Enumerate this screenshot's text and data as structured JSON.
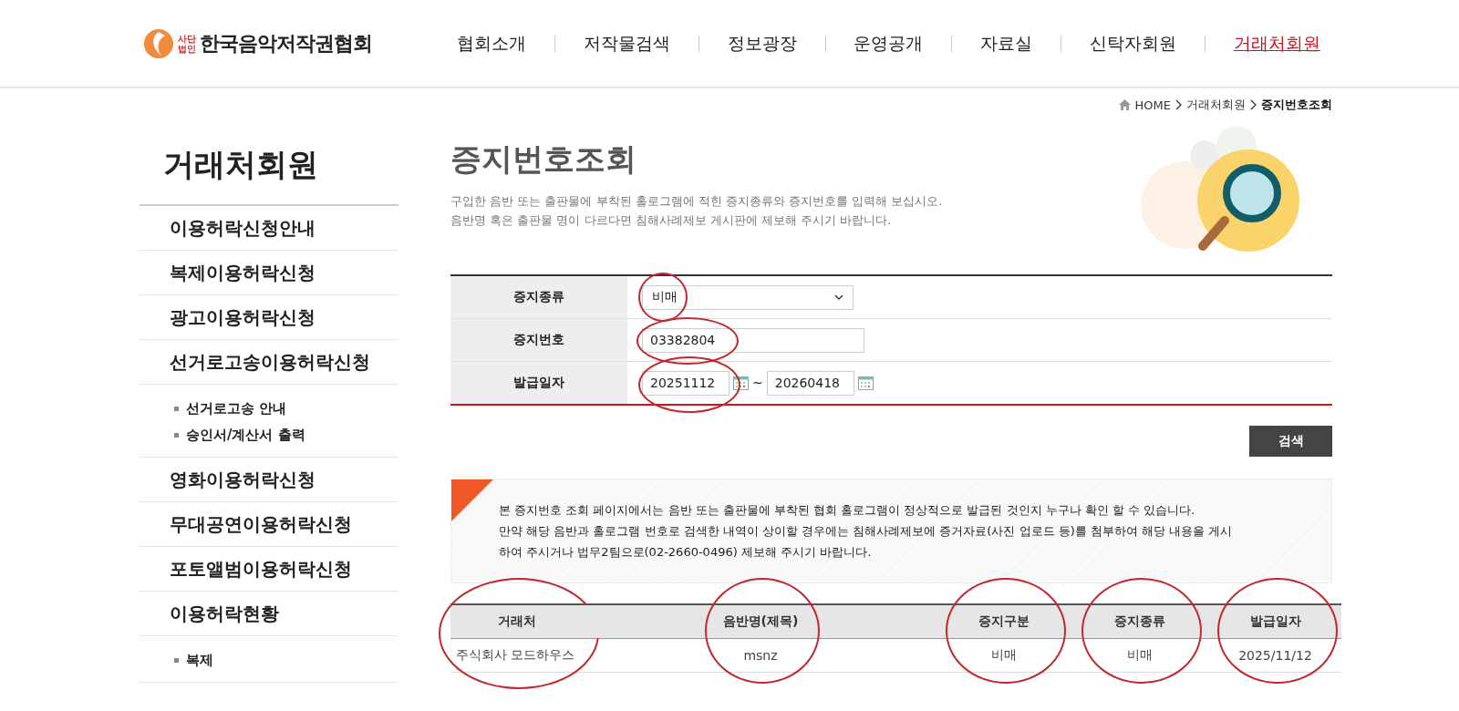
{
  "logo": {
    "badge_top": "사단",
    "badge_bottom": "법인",
    "name": "한국음악저작권협회"
  },
  "nav": [
    {
      "label": "협회소개",
      "selected": false
    },
    {
      "label": "저작물검색",
      "selected": false
    },
    {
      "label": "정보광장",
      "selected": false
    },
    {
      "label": "운영공개",
      "selected": false
    },
    {
      "label": "자료실",
      "selected": false
    },
    {
      "label": "신탁자회원",
      "selected": false
    },
    {
      "label": "거래처회원",
      "selected": true
    }
  ],
  "sidebar": {
    "title": "거래처회원",
    "items": [
      {
        "label": "이용허락신청안내"
      },
      {
        "label": "복제이용허락신청"
      },
      {
        "label": "광고이용허락신청"
      },
      {
        "label": "선거로고송이용허락신청",
        "children": [
          {
            "label": "선거로고송 안내"
          },
          {
            "label": "승인서/계산서 출력"
          }
        ]
      },
      {
        "label": "영화이용허락신청"
      },
      {
        "label": "무대공연이용허락신청"
      },
      {
        "label": "포토앨범이용허락신청"
      },
      {
        "label": "이용허락현황",
        "children": [
          {
            "label": "복제"
          }
        ]
      }
    ]
  },
  "breadcrumb": [
    {
      "label": "HOME",
      "current": false
    },
    {
      "label": "거래처회원",
      "current": false
    },
    {
      "label": "증지번호조회",
      "current": true
    }
  ],
  "page": {
    "title": "증지번호조회",
    "description": [
      "구입한 음반 또는 출판물에 부착된 홀로그램에 적힌 증지종류와 증지번호를 입력해 보십시오.",
      "음반명 혹은 출판물 명이 다르다면 침해사례제보 게시판에 제보해 주시기 바랍니다."
    ]
  },
  "form": {
    "rows": [
      {
        "label": "증지종류",
        "kind": "select",
        "value": "비매",
        "circled": true
      },
      {
        "label": "증지번호",
        "kind": "text",
        "value": "03382804",
        "circled": true
      },
      {
        "label": "발급일자",
        "kind": "date_range",
        "from": "20251112",
        "separator": "~",
        "to": "20260418",
        "circled": true
      }
    ]
  },
  "search_button": "검색",
  "notice": [
    "본 증지번호 조회 페이지에서는 음반 또는 출판물에 부착된 협회 홀로그램이 정상적으로 발급된 것인지 누구나 확인 할 수 있습니다.",
    "만약 해당 음반과 홀로그램 번호로 검색한 내역이 상이할 경우에는 침해사례제보에 증거자료(사진 업로드 등)를 첨부하여 해당 내용을 게시",
    "하여 주시거나 법무2팀으로(02-2660-0496) 제보해 주시기 바랍니다."
  ],
  "results": {
    "columns": [
      {
        "label": "거래처",
        "circled": true
      },
      {
        "label": "음반명(제목)",
        "circled": true
      },
      {
        "label": "증지구분",
        "circled": true
      },
      {
        "label": "증지종류",
        "circled": true
      },
      {
        "label": "발급일자",
        "circled": true
      }
    ],
    "rows": [
      [
        "주식회사 모드하우스",
        "msnz",
        "비매",
        "비매",
        "2025/11/12"
      ]
    ]
  }
}
